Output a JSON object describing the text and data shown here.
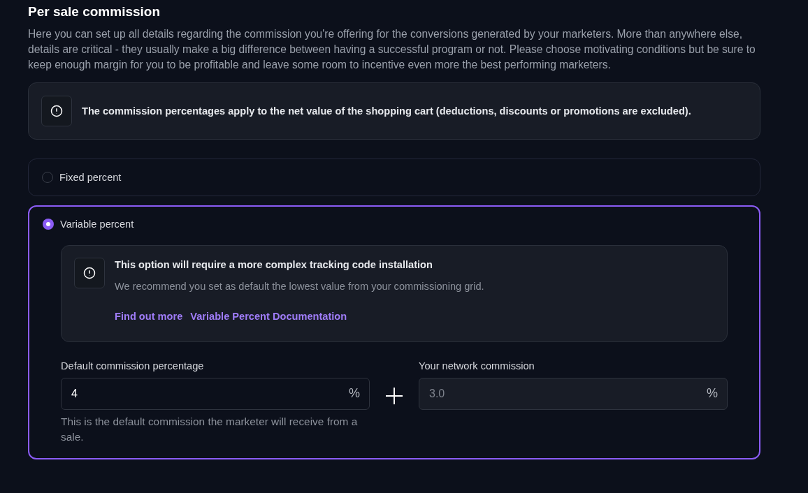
{
  "title": "Per sale commission",
  "description": "Here you can set up all details regarding the commission you're offering for the conversions generated by your marketers. More than anywhere else, details are critical - they usually make a big difference between having a successful program or not. Please choose motivating conditions but be sure to keep enough margin for you to be profitable and leave some room to incentive even more the best performing marketers.",
  "notice": "The commission percentages apply to the net value of the shopping cart (deductions, discounts or promotions are excluded).",
  "options": [
    {
      "label": "Fixed percent",
      "selected": false
    },
    {
      "label": "Variable percent",
      "selected": true,
      "details": {
        "alert": {
          "title": "This option will require a more complex tracking code installation",
          "text": "We recommend you set as default the lowest value from your commissioning grid.",
          "links": [
            "Find out more",
            "Variable Percent Documentation"
          ]
        },
        "fields": [
          {
            "label": "Default commission percentage",
            "value": "4",
            "unit": "%",
            "disabled": false,
            "help": "This is the default commission the marketer will receive from a sale."
          },
          {
            "label": "Your network commission",
            "value": "3.0",
            "unit": "%",
            "disabled": true
          }
        ]
      }
    }
  ]
}
